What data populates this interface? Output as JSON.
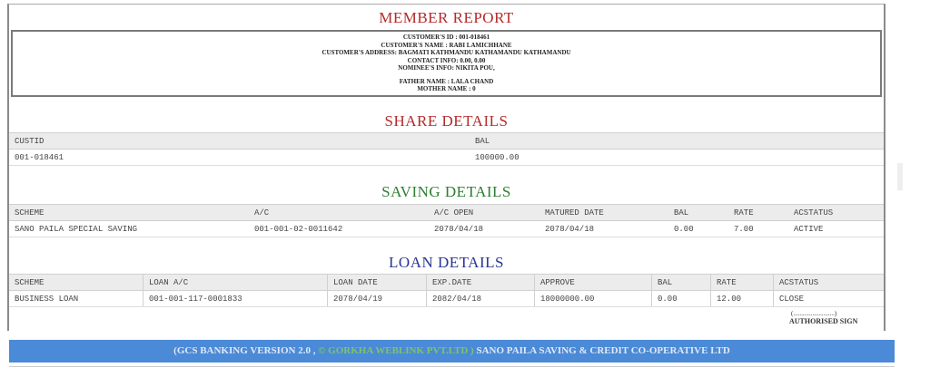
{
  "report": {
    "title": "MEMBER REPORT",
    "customer": {
      "id_line": "CUSTOMER'S ID : 001-018461",
      "name_line": "CUSTOMER'S NAME : RABI LAMICHHANE",
      "address_line": "CUSTOMER'S ADDRESS: BAGMATI KATHMANDU KATHAMANDU KATHAMANDU",
      "contact_line": "CONTACT INFO: 0.00, 0.00",
      "nominee_line": "NOMINEE'S INFO: NIKITA POU,",
      "father_line": "FATHER NAME : LALA CHAND",
      "mother_line": "MOTHER NAME : 0"
    }
  },
  "share": {
    "title": "SHARE DETAILS",
    "headers": [
      "CUSTID",
      "BAL"
    ],
    "rows": [
      [
        "001-018461",
        "100000.00"
      ]
    ]
  },
  "saving": {
    "title": "SAVING DETAILS",
    "headers": [
      "SCHEME",
      "A/C",
      "A/C OPEN",
      "MATURED DATE",
      "BAL",
      "RATE",
      "ACSTATUS"
    ],
    "rows": [
      [
        "SANO PAILA SPECIAL SAVING",
        "001-001-02-0011642",
        "2078/04/18",
        "2078/04/18",
        "0.00",
        "7.00",
        "ACTIVE"
      ]
    ]
  },
  "loan": {
    "title": "LOAN DETAILS",
    "headers": [
      "SCHEME",
      "LOAN A/C",
      "LOAN DATE",
      "EXP.DATE",
      "APPROVE",
      "BAL",
      "RATE",
      "ACSTATUS"
    ],
    "rows": [
      [
        "BUSINESS LOAN",
        "001-001-117-0001833",
        "2078/04/19",
        "2082/04/18",
        "18000000.00",
        "0.00",
        "12.00",
        "CLOSE"
      ]
    ]
  },
  "signature": {
    "dots": "(..........................)",
    "label": "AUTHORISED SIGN"
  },
  "footer": {
    "prefix": "(GCS BANKING VERSION 2.0 , ",
    "copyright": "© GORKHA WEBLINK PVT.LTD )",
    "suffix": " SANO PAILA SAVING & CREDIT CO-OPERATIVE LTD"
  }
}
